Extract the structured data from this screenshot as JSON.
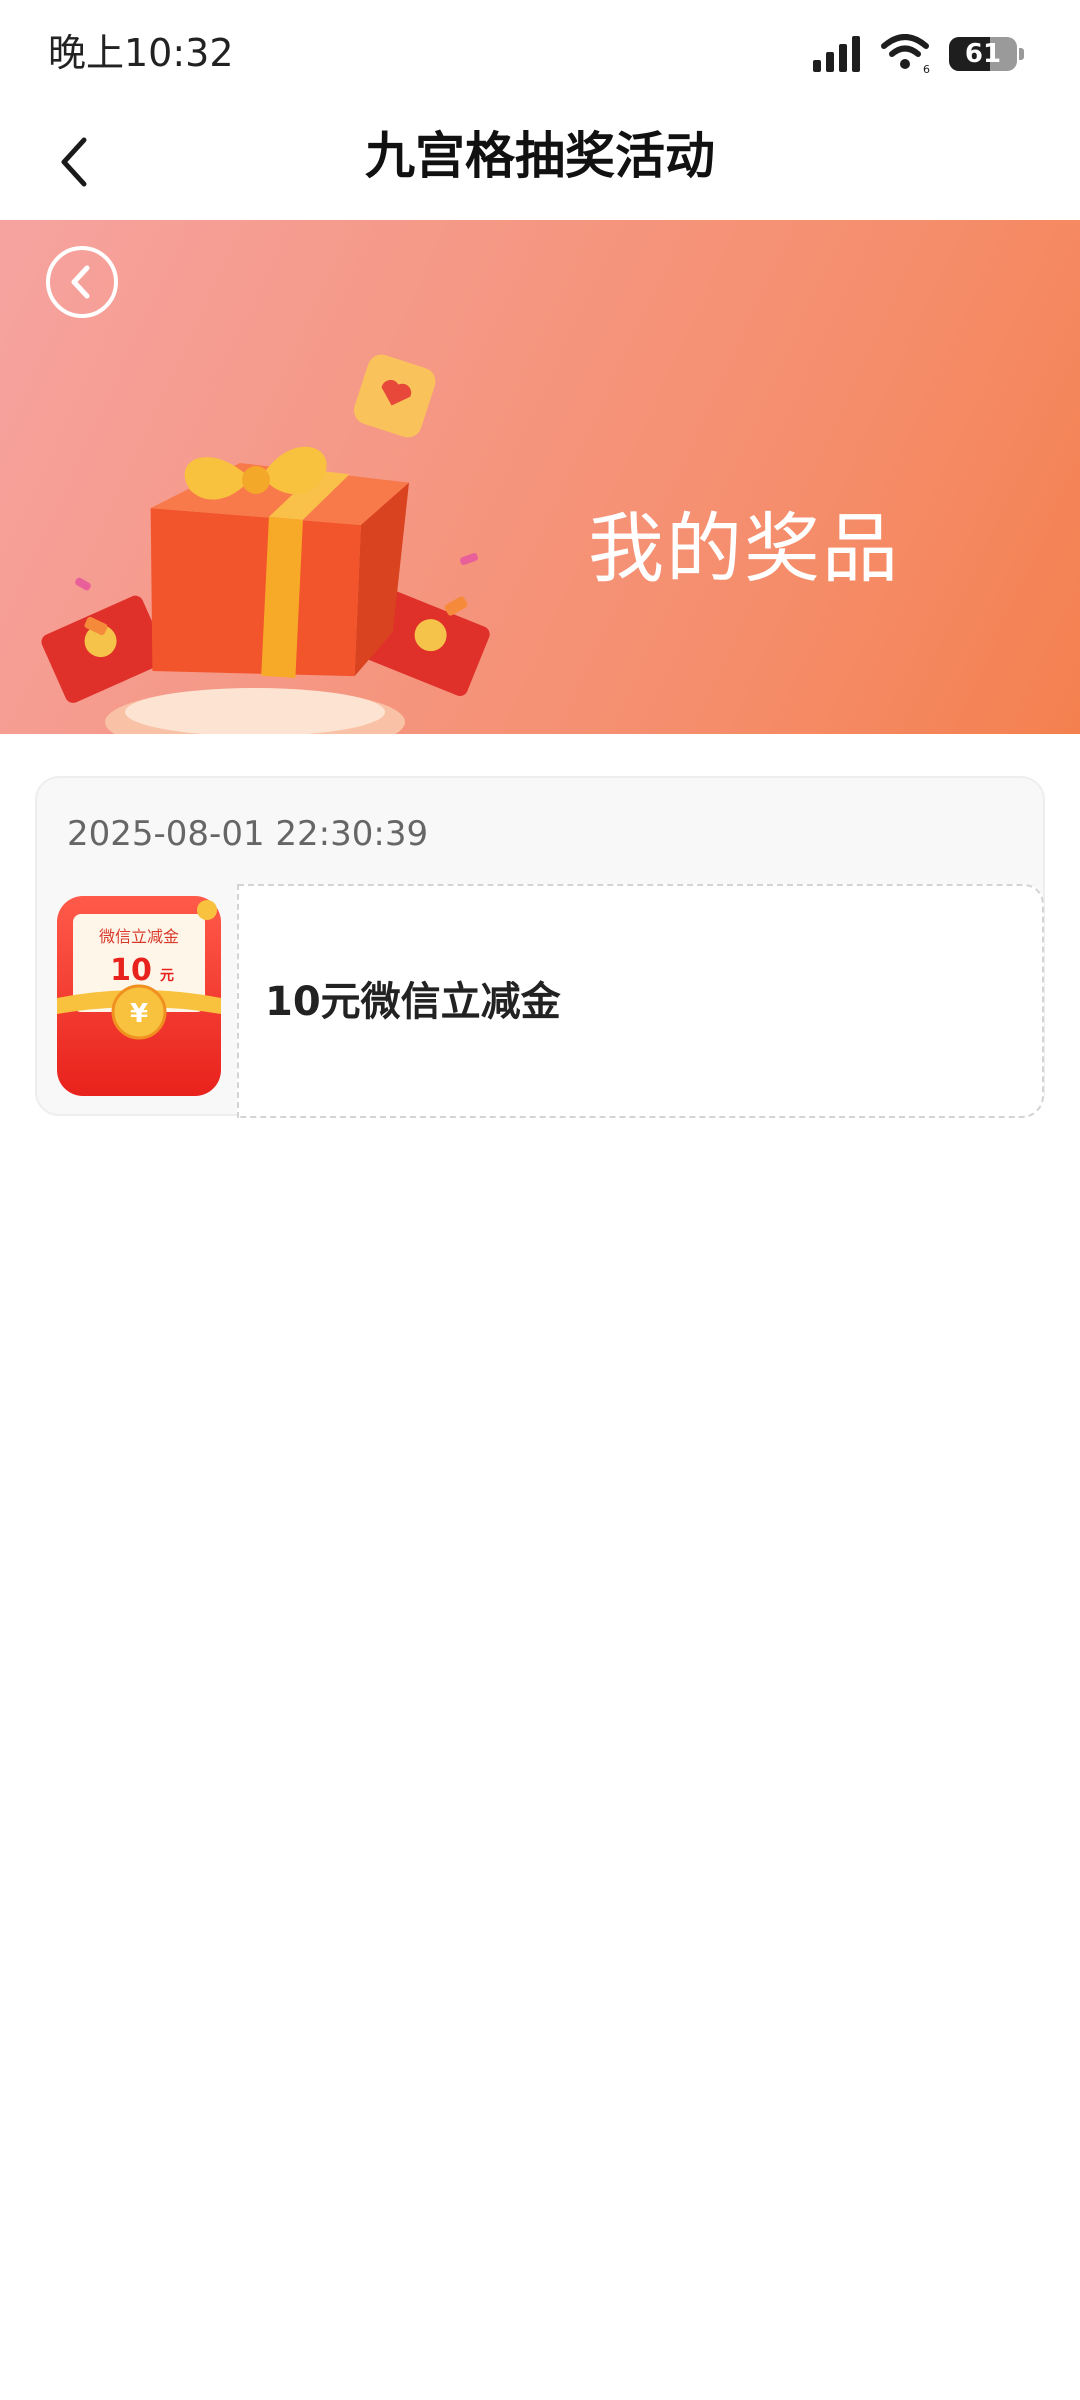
{
  "status_bar": {
    "time": "晚上10:32",
    "battery": "61",
    "battery_level": 0.61,
    "icons": [
      "signal-icon",
      "wifi-icon",
      "battery-icon"
    ]
  },
  "nav": {
    "title": "九宫格抽奖活动",
    "back_icon": "chevron-left-icon"
  },
  "banner": {
    "title": "我的奖品",
    "back_icon": "circle-chevron-left-icon",
    "colors": {
      "gradient_start": "#f6a3a0",
      "gradient_end": "#f4804f"
    }
  },
  "prizes": [
    {
      "time": "2025-08-01 22:30:39",
      "name": "10元微信立减金",
      "image": {
        "label": "微信立减金",
        "amount": "10",
        "unit": "元"
      }
    }
  ]
}
